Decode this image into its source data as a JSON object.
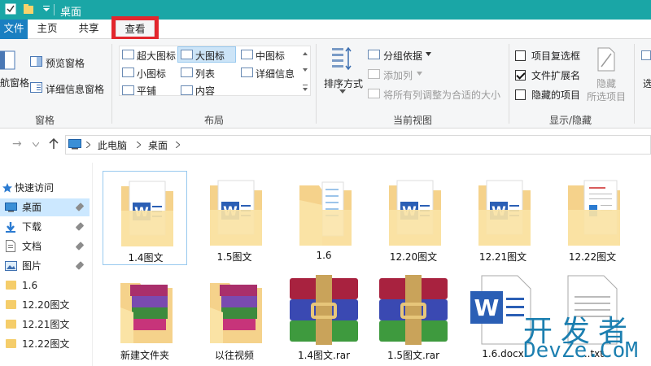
{
  "window": {
    "title": "桌面",
    "title_bar_color": "#1aa6a6"
  },
  "ribbon": {
    "tabs": [
      {
        "label": "文件"
      },
      {
        "label": "主页"
      },
      {
        "label": "共享"
      },
      {
        "label": "查看",
        "selected": true,
        "highlighted": true
      }
    ],
    "panes_group": {
      "name": "窗格",
      "nav_pane": "航窗格",
      "preview_pane": "预览窗格",
      "details_pane": "详细信息窗格"
    },
    "layout_group": {
      "name": "布局",
      "options": [
        "超大图标",
        "大图标",
        "中图标",
        "小图标",
        "列表",
        "详细信息",
        "平铺",
        "内容"
      ],
      "selected": "大图标"
    },
    "current_view_group": {
      "name": "当前视图",
      "sort_by": "排序方式",
      "group_by": "分组依据",
      "add_column": "添加列",
      "size_columns": "将所有列调整为合适的大小"
    },
    "show_hide_group": {
      "name": "显示/隐藏",
      "item_checkboxes": {
        "label": "项目复选框",
        "checked": false
      },
      "file_extensions": {
        "label": "文件扩展名",
        "checked": true
      },
      "hidden_items": {
        "label": "隐藏的项目",
        "checked": false
      },
      "hide_selected_top": "隐藏",
      "hide_selected_bottom": "所选项目",
      "options_partial": "选"
    }
  },
  "address": {
    "crumbs": [
      "此电脑",
      "桌面"
    ]
  },
  "nav": {
    "quick_access": "快速访问",
    "items": [
      {
        "label": "桌面",
        "selected": true,
        "pinned": true
      },
      {
        "label": "下载",
        "pinned": true
      },
      {
        "label": "文档",
        "pinned": true
      },
      {
        "label": "图片",
        "pinned": true
      },
      {
        "label": "1.6"
      },
      {
        "label": "12.20图文"
      },
      {
        "label": "12.21图文"
      },
      {
        "label": "12.22图文"
      }
    ]
  },
  "files": [
    {
      "name": "1.4图文",
      "type": "folder-word",
      "selected": true
    },
    {
      "name": "1.5图文",
      "type": "folder-word"
    },
    {
      "name": "1.6",
      "type": "folder-docs"
    },
    {
      "name": "12.20图文",
      "type": "folder-word"
    },
    {
      "name": "12.21图文",
      "type": "folder-word"
    },
    {
      "name": "12.22图文",
      "type": "folder-doc2"
    },
    {
      "name": "新建文件夹",
      "type": "folder-books"
    },
    {
      "name": "以往视频",
      "type": "folder-books"
    },
    {
      "name": "1.4图文.rar",
      "type": "rar"
    },
    {
      "name": "1.5图文.rar",
      "type": "rar"
    },
    {
      "name": "1.6.docx",
      "type": "docx"
    },
    {
      "name": "...txt",
      "type": "txt"
    }
  ],
  "watermark": {
    "line1": "开发者",
    "line2": "DevZe.CoM"
  }
}
